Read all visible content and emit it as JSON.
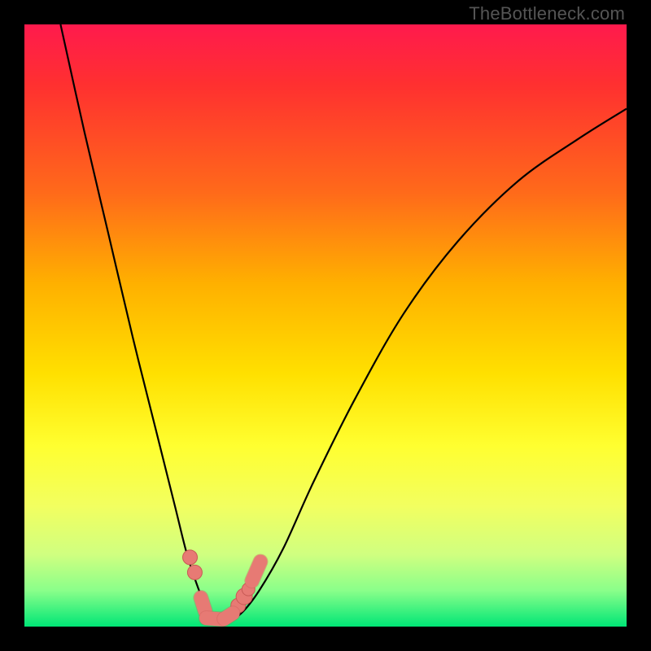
{
  "watermark": "TheBottleneck.com",
  "chart_data": {
    "type": "line",
    "title": "",
    "xlabel": "",
    "ylabel": "",
    "xlim": [
      0,
      100
    ],
    "ylim": [
      0,
      100
    ],
    "series": [
      {
        "name": "bottleneck-curve",
        "x": [
          6,
          10,
          14,
          18,
          22,
          25,
          27,
          29,
          30.5,
          32,
          34,
          36,
          39,
          43,
          48,
          55,
          63,
          72,
          82,
          92,
          100
        ],
        "values": [
          100,
          82,
          65,
          48,
          32,
          20,
          12,
          6,
          2.5,
          1.2,
          1.2,
          2.2,
          6,
          13,
          24,
          38,
          52,
          64,
          74,
          81,
          86
        ]
      }
    ],
    "markers": [
      {
        "name": "dots",
        "shape": "circle",
        "x": [
          27.5,
          28.3,
          35.5,
          36.5,
          37.2
        ],
        "values": [
          11.5,
          9.0,
          3.5,
          5.0,
          6.2
        ],
        "size": [
          9,
          9,
          9,
          10,
          8
        ]
      },
      {
        "name": "pills",
        "shape": "pill",
        "segments": [
          {
            "x1": 29.3,
            "y1": 4.8,
            "x2": 30.0,
            "y2": 2.6
          },
          {
            "x1": 30.2,
            "y1": 1.4,
            "x2": 32.8,
            "y2": 1.2
          },
          {
            "x1": 33.2,
            "y1": 1.3,
            "x2": 34.6,
            "y2": 2.2
          },
          {
            "x1": 37.8,
            "y1": 7.6,
            "x2": 39.2,
            "y2": 10.8
          }
        ]
      }
    ],
    "colors": {
      "curve": "#000000",
      "marker_fill": "#e77a74",
      "marker_stroke": "#c85a55"
    }
  }
}
